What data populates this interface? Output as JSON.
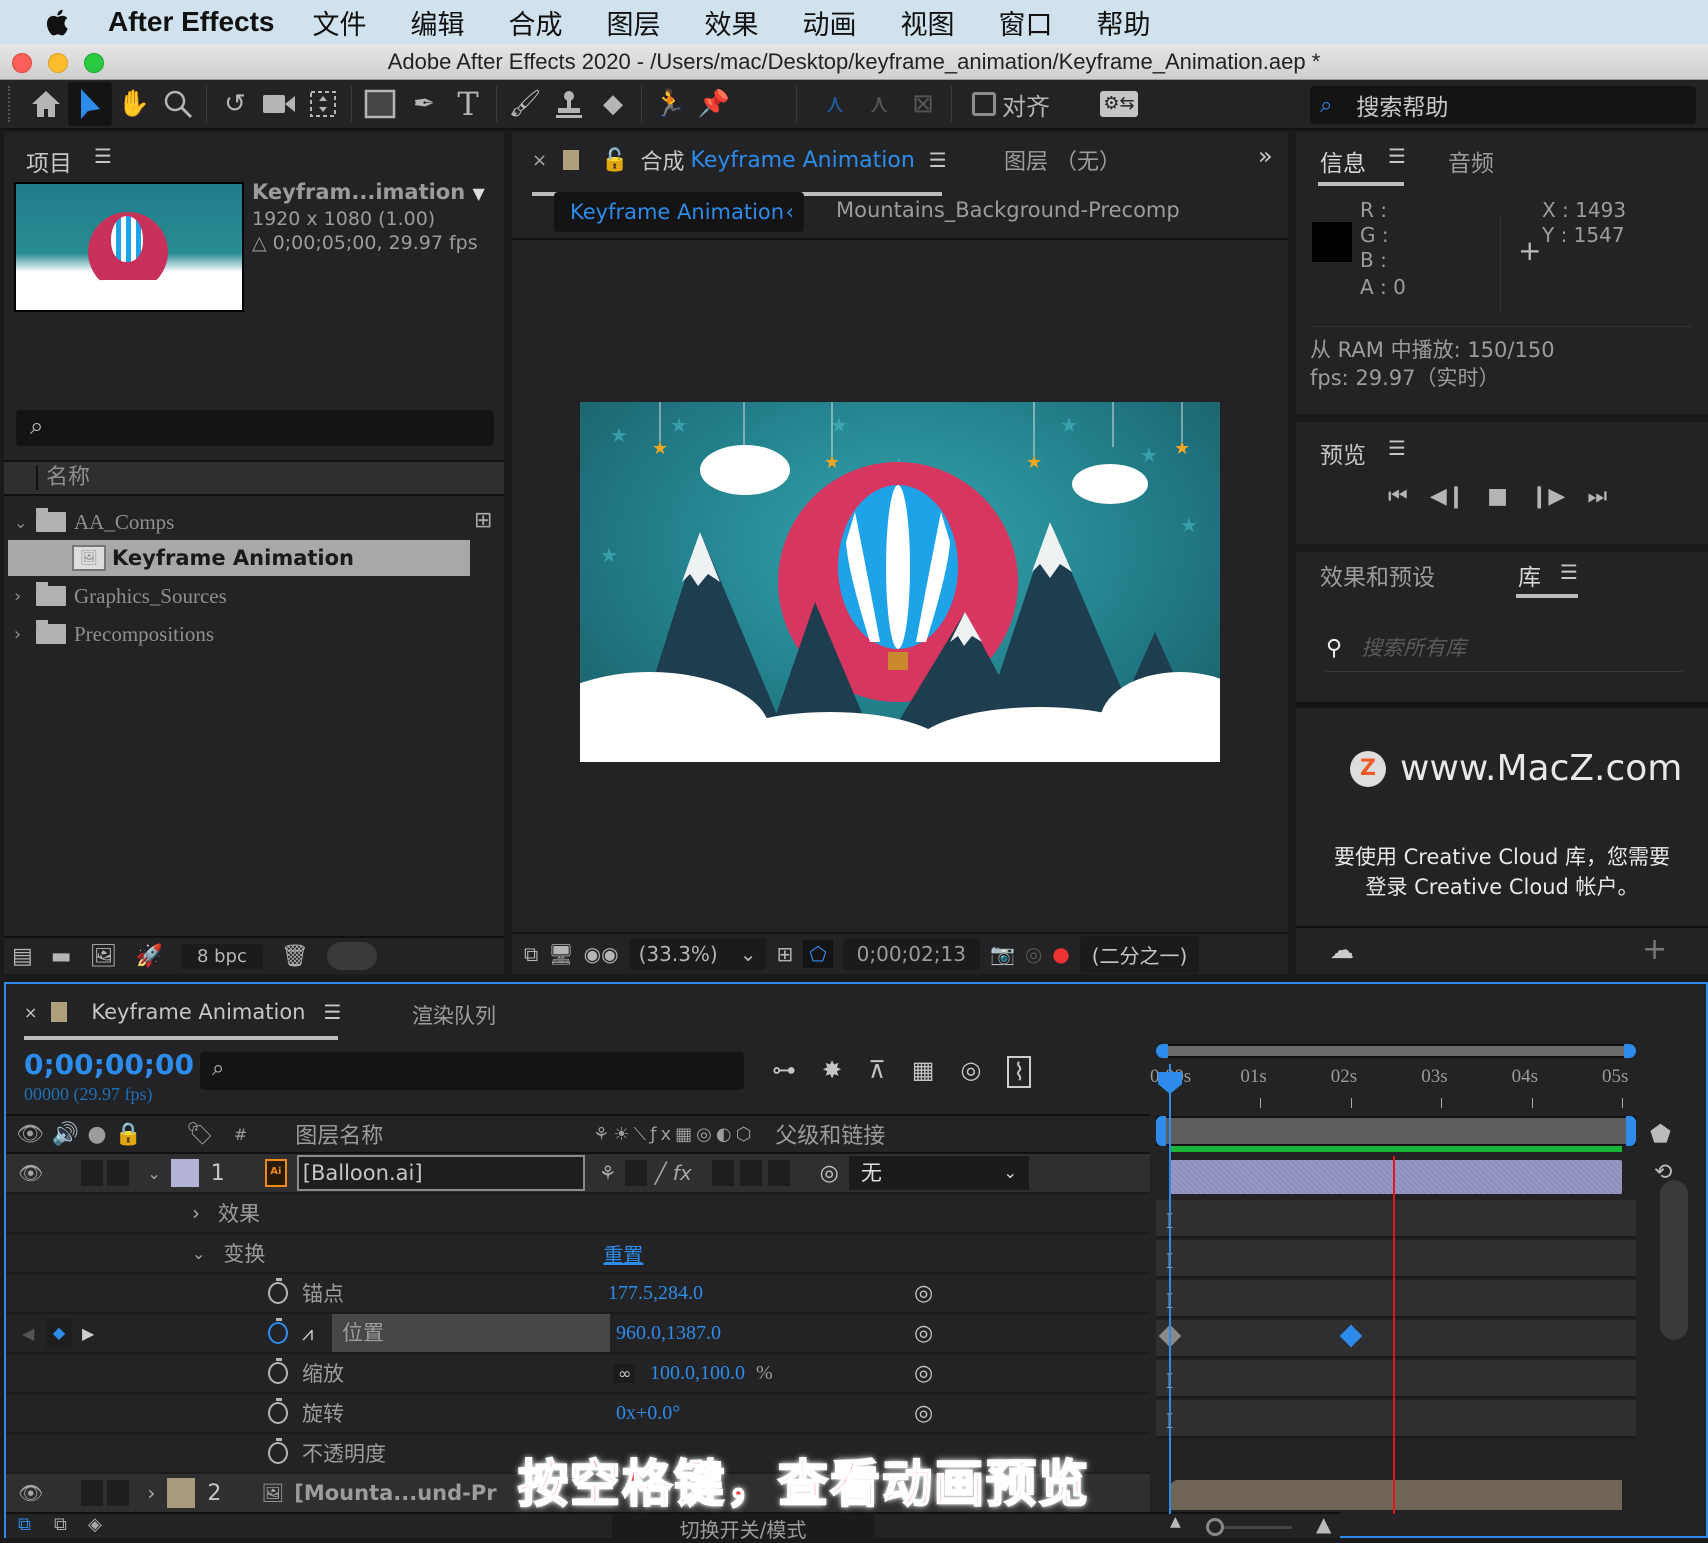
{
  "menubar": {
    "app_name": "After Effects",
    "items": [
      "文件",
      "编辑",
      "合成",
      "图层",
      "效果",
      "动画",
      "视图",
      "窗口",
      "帮助"
    ]
  },
  "window": {
    "title": "Adobe After Effects 2020 - /Users/mac/Desktop/keyframe_animation/Keyframe_Animation.aep *"
  },
  "toolbar": {
    "tools": [
      "home-icon",
      "selection-tool-icon",
      "hand-tool-icon",
      "zoom-tool-icon",
      "rotate-tool-icon",
      "camera-tool-icon",
      "pan-behind-tool-icon",
      "rectangle-tool-icon",
      "pen-tool-icon",
      "type-tool-icon",
      "brush-tool-icon",
      "clone-stamp-tool-icon",
      "eraser-tool-icon",
      "roto-brush-tool-icon",
      "puppet-pin-tool-icon"
    ],
    "align_label": "对齐",
    "search_help_placeholder": "搜索帮助"
  },
  "project_panel": {
    "title": "项目",
    "selected_item": {
      "name": "Keyfram...imation",
      "dimensions": "1920 x 1080 (1.00)",
      "duration": "△ 0;00;05;00, 29.97 fps"
    },
    "search_placeholder": "",
    "column_name": "名称",
    "items": [
      {
        "name": "AA_Comps",
        "type": "folder",
        "expanded": true
      },
      {
        "name": "Keyframe Animation",
        "type": "composition",
        "selected": true
      },
      {
        "name": "Graphics_Sources",
        "type": "folder",
        "expanded": false
      },
      {
        "name": "Precompositions",
        "type": "folder",
        "expanded": false
      }
    ],
    "bpc": "8 bpc"
  },
  "comp_panel": {
    "tab_prefix": "合成",
    "tab_name": "Keyframe Animation",
    "layer_tab": "图层 （无）",
    "breadcrumbs": [
      "Keyframe Animation",
      "Mountains_Background-Precomp"
    ],
    "zoom": "(33.3%)",
    "timecode": "0;00;02;13",
    "resolution": "(二分之一)"
  },
  "info_panel": {
    "tabs": [
      "信息",
      "音频"
    ],
    "r": "R :",
    "g": "G :",
    "b": "B :",
    "a": "A :  0",
    "x": "X : 1493",
    "y": "Y :  1547",
    "ram_preview": "从 RAM 中播放: 150/150",
    "fps": "fps: 29.97（实时）"
  },
  "preview_panel": {
    "title": "预览"
  },
  "library_panel": {
    "tabs": [
      "效果和预设",
      "库"
    ],
    "search_placeholder": "搜索所有库",
    "watermark": "www.MacZ.com",
    "message_line1": "要使用 Creative Cloud 库，您需要",
    "message_line2": "登录 Creative Cloud 帐户。"
  },
  "timeline": {
    "tabs": [
      "Keyframe Animation",
      "渲染队列"
    ],
    "current_time": "0;00;00;00",
    "frame_info": "00000 (29.97 fps)",
    "columns": {
      "layer_name": "图层名称",
      "parent": "父级和链接",
      "number": "#"
    },
    "ruler": [
      "0:00s",
      "01s",
      "02s",
      "03s",
      "04s",
      "05s"
    ],
    "layers": [
      {
        "number": "1",
        "name": "[Balloon.ai]",
        "parent": "无",
        "label_color": "#b3b2d8"
      },
      {
        "number": "2",
        "name": "[Mounta...und-Pr",
        "parent": "",
        "label_color": "#a89a7d"
      }
    ],
    "properties": {
      "effects": "效果",
      "transform": "变换",
      "reset": "重置",
      "anchor_label": "锚点",
      "anchor_value": "177.5,284.0",
      "position_label": "位置",
      "position_value": "960.0,1387.0",
      "scale_label": "缩放",
      "scale_value": "100.0,100.0",
      "scale_unit": "%",
      "rotation_label": "旋转",
      "rotation_value": "0x+0.0°",
      "opacity_label": "不透明度"
    },
    "keyframes_seconds": [
      0,
      2
    ],
    "current_time_indicator_seconds": 0,
    "marker_seconds": 2.47,
    "duration_seconds": 5,
    "toggle_label": "切换开关/模式",
    "subtitle": "按空格键，查看动画预览"
  }
}
